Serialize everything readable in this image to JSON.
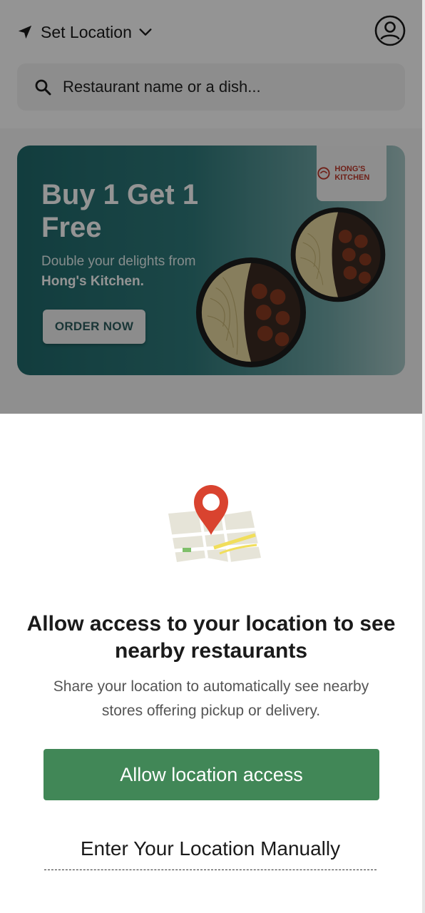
{
  "header": {
    "location_label": "Set Location",
    "search_placeholder": "Restaurant name or a dish..."
  },
  "banner": {
    "title": "Buy 1 Get 1 Free",
    "subtitle_prefix": "Double your delights from",
    "subtitle_brand": "Hong's Kitchen.",
    "cta_label": "ORDER NOW",
    "logo_text": "HONG'S KITCHEN"
  },
  "sheet": {
    "title": "Allow access to your location to see nearby restaurants",
    "description": "Share your location to automatically see nearby stores offering pickup or delivery.",
    "allow_button": "Allow location access",
    "manual_link": "Enter Your Location Manually"
  },
  "colors": {
    "primary_green": "#418757",
    "banner_teal": "#2f7a7b",
    "pin_red": "#d9432f"
  },
  "icons": [
    "navigation-arrow-icon",
    "chevron-down-icon",
    "user-profile-icon",
    "search-icon",
    "map-pin-icon"
  ]
}
